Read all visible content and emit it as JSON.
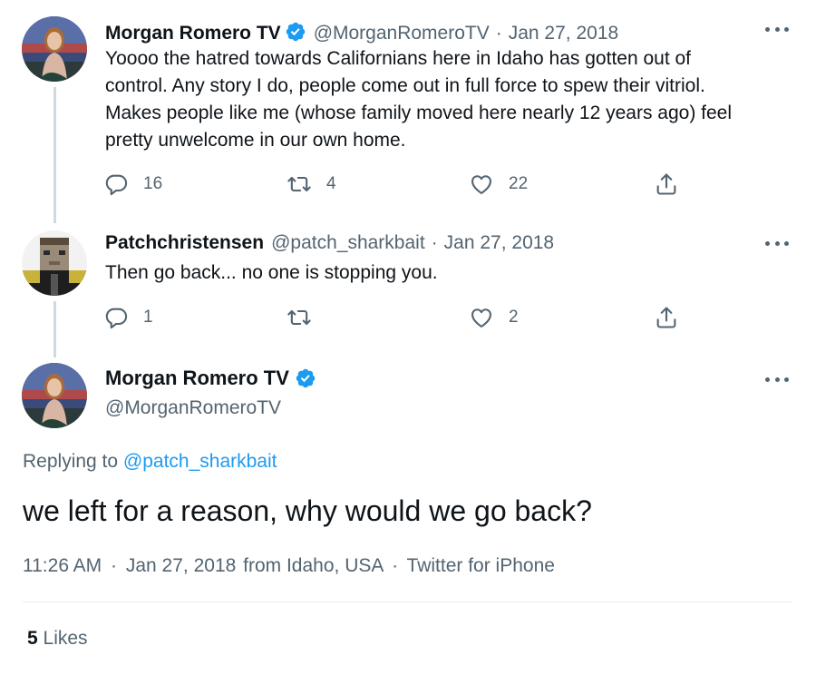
{
  "tweets": [
    {
      "name": "Morgan Romero TV",
      "verified": true,
      "handle": "@MorganRomeroTV",
      "date": "Jan 27, 2018",
      "text_lines": [
        "Yoooo the hatred towards Californians here in Idaho has gotten out of",
        "control. Any story I do, people come out in full force to spew their vitriol.",
        "Makes people like me (whose family moved here nearly 12 years ago) feel",
        "pretty unwelcome in our own home."
      ],
      "replies": "16",
      "retweets": "4",
      "likes": "22"
    },
    {
      "name": "Patchchristensen",
      "verified": false,
      "handle": "@patch_sharkbait",
      "date": "Jan 27, 2018",
      "text_lines": [
        "Then go back... no one is stopping you."
      ],
      "replies": "1",
      "retweets": "",
      "likes": "2"
    }
  ],
  "main_tweet": {
    "name": "Morgan Romero TV",
    "verified": true,
    "handle": "@MorganRomeroTV",
    "replying_label": "Replying to",
    "replying_handle": "@patch_sharkbait",
    "text": "we left for a reason, why would we go back?",
    "time": "11:26 AM",
    "date": "Jan 27, 2018",
    "location_label": "from Idaho, USA",
    "source": "Twitter for iPhone",
    "likes_count": "5",
    "likes_label": "Likes"
  },
  "separator": "·",
  "icons": {
    "reply": "reply-icon",
    "retweet": "retweet-icon",
    "like": "heart-icon",
    "share": "share-icon",
    "verified": "verified-badge-icon",
    "more": "more-options-icon"
  },
  "colors": {
    "accent": "#1d9bf0",
    "text": "#0f1419",
    "secondary": "#536471",
    "line": "#cfd9de"
  }
}
